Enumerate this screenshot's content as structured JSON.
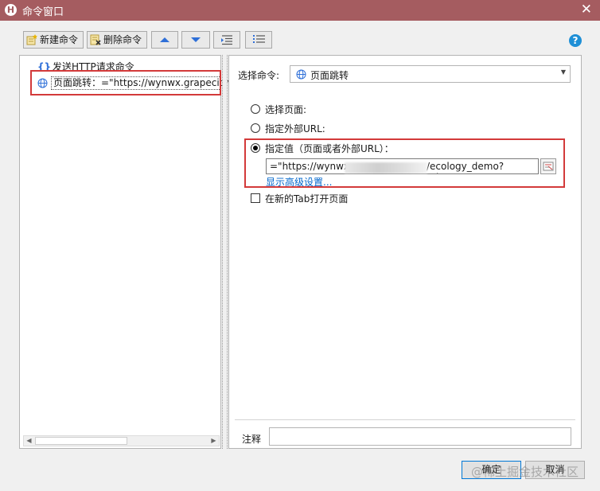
{
  "window": {
    "title": "命令窗口",
    "app_icon_letter": "H"
  },
  "toolbar": {
    "new_command": "新建命令",
    "delete_command": "删除命令",
    "help": "?"
  },
  "tree": {
    "items": [
      {
        "label": "发送HTTP请求命令",
        "icon": "braces-icon"
      },
      {
        "label": "页面跳转：=\"https://wynwx.grapecity",
        "icon": "globe-icon"
      }
    ]
  },
  "form": {
    "select_command_label": "选择命令:",
    "select_command_value": "页面跳转",
    "radio_select_page": "选择页面:",
    "radio_external_url": "指定外部URL:",
    "radio_specify_value": "指定值（页面或者外部URL）：",
    "url_value_prefix": "=\"https://wynwx",
    "url_value_suffix": "/ecology_demo?token=\"",
    "show_advanced": "显示高级设置...",
    "open_new_tab": "在新的Tab打开页面",
    "note_label": "注释",
    "note_value": ""
  },
  "buttons": {
    "ok": "确定",
    "cancel": "取消"
  },
  "watermark": "@稀土掘金技术社区",
  "colors": {
    "titlebar": "#a55c60",
    "highlight_box": "#d33a3a",
    "link": "#0066cc",
    "help": "#1e8fd6"
  }
}
